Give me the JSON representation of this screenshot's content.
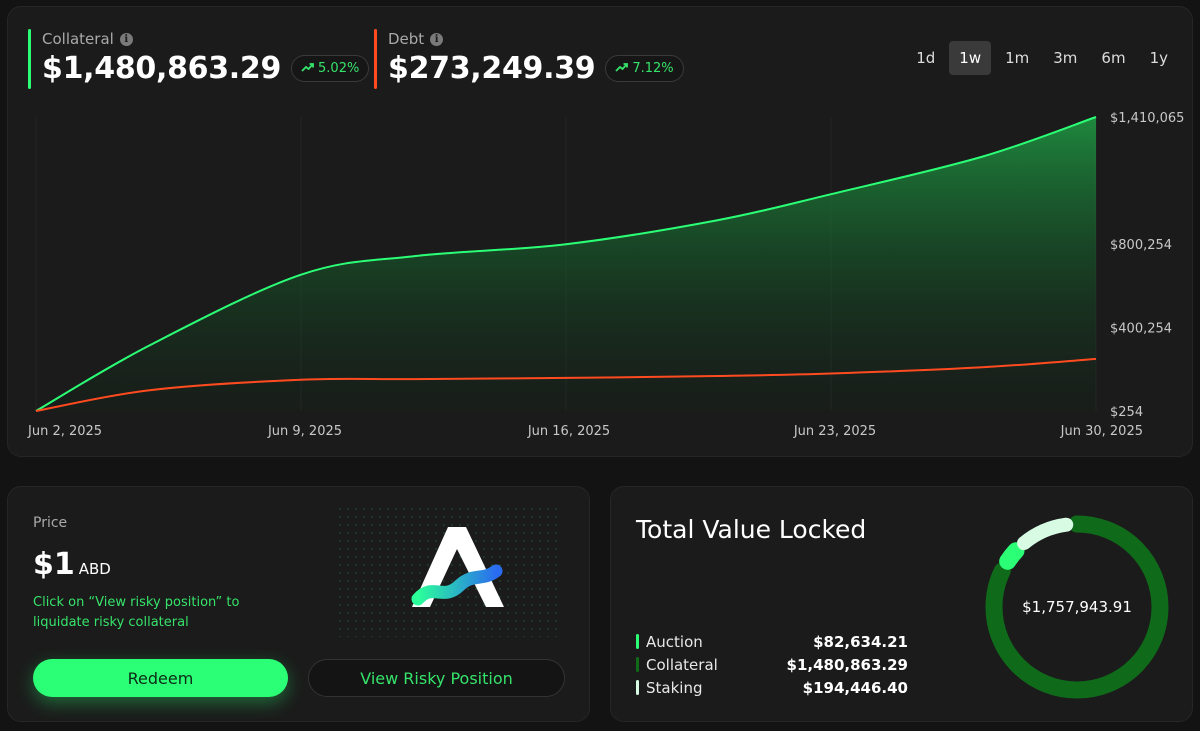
{
  "metrics": {
    "collateral": {
      "label": "Collateral",
      "value": "$1,480,863.29",
      "change": "5.02%",
      "color": "#2bff76"
    },
    "debt": {
      "label": "Debt",
      "value": "$273,249.39",
      "change": "7.12%",
      "color": "#ff4b1f"
    }
  },
  "ranges": [
    {
      "label": "1d",
      "active": false
    },
    {
      "label": "1w",
      "active": true
    },
    {
      "label": "1m",
      "active": false
    },
    {
      "label": "3m",
      "active": false
    },
    {
      "label": "6m",
      "active": false
    },
    {
      "label": "1y",
      "active": false
    }
  ],
  "chart_data": {
    "type": "area",
    "x_tick_labels": [
      "Jun 2, 2025",
      "Jun 9, 2025",
      "Jun 16, 2025",
      "Jun 23, 2025",
      "Jun 30, 2025"
    ],
    "y_tick_labels": [
      "$1,410,065",
      "$800,254",
      "$400,254",
      "$254"
    ],
    "ylim": [
      254,
      1410065
    ],
    "series": [
      {
        "name": "Collateral",
        "color": "#2bff76",
        "x": [
          "2025-06-02",
          "2025-06-05",
          "2025-06-09",
          "2025-06-12",
          "2025-06-16",
          "2025-06-20",
          "2025-06-23",
          "2025-06-27",
          "2025-06-30"
        ],
        "values": [
          254,
          315000,
          654000,
          743000,
          800000,
          915000,
          1040000,
          1220000,
          1410065
        ]
      },
      {
        "name": "Debt",
        "color": "#ff4b1f",
        "x": [
          "2025-06-02",
          "2025-06-05",
          "2025-06-09",
          "2025-06-12",
          "2025-06-16",
          "2025-06-20",
          "2025-06-23",
          "2025-06-27",
          "2025-06-30"
        ],
        "values": [
          254,
          100000,
          150000,
          153000,
          159000,
          168000,
          180000,
          210000,
          250000
        ]
      }
    ],
    "grid": true
  },
  "price": {
    "label": "Price",
    "value": "$1",
    "unit": "ABD",
    "hint": "Click on “View risky position” to liquidate risky collateral",
    "redeem_label": "Redeem",
    "risky_label": "View Risky Position"
  },
  "tvl": {
    "title": "Total Value Locked",
    "total": "$1,757,943.91",
    "items": [
      {
        "name": "Auction",
        "amount": "$82,634.21",
        "value": 82634.21,
        "color": "#2bff76"
      },
      {
        "name": "Collateral",
        "amount": "$1,480,863.29",
        "value": 1480863.29,
        "color": "#0f6b1a"
      },
      {
        "name": "Staking",
        "amount": "$194,446.40",
        "value": 194446.4,
        "color": "#d7fbe3"
      }
    ]
  }
}
